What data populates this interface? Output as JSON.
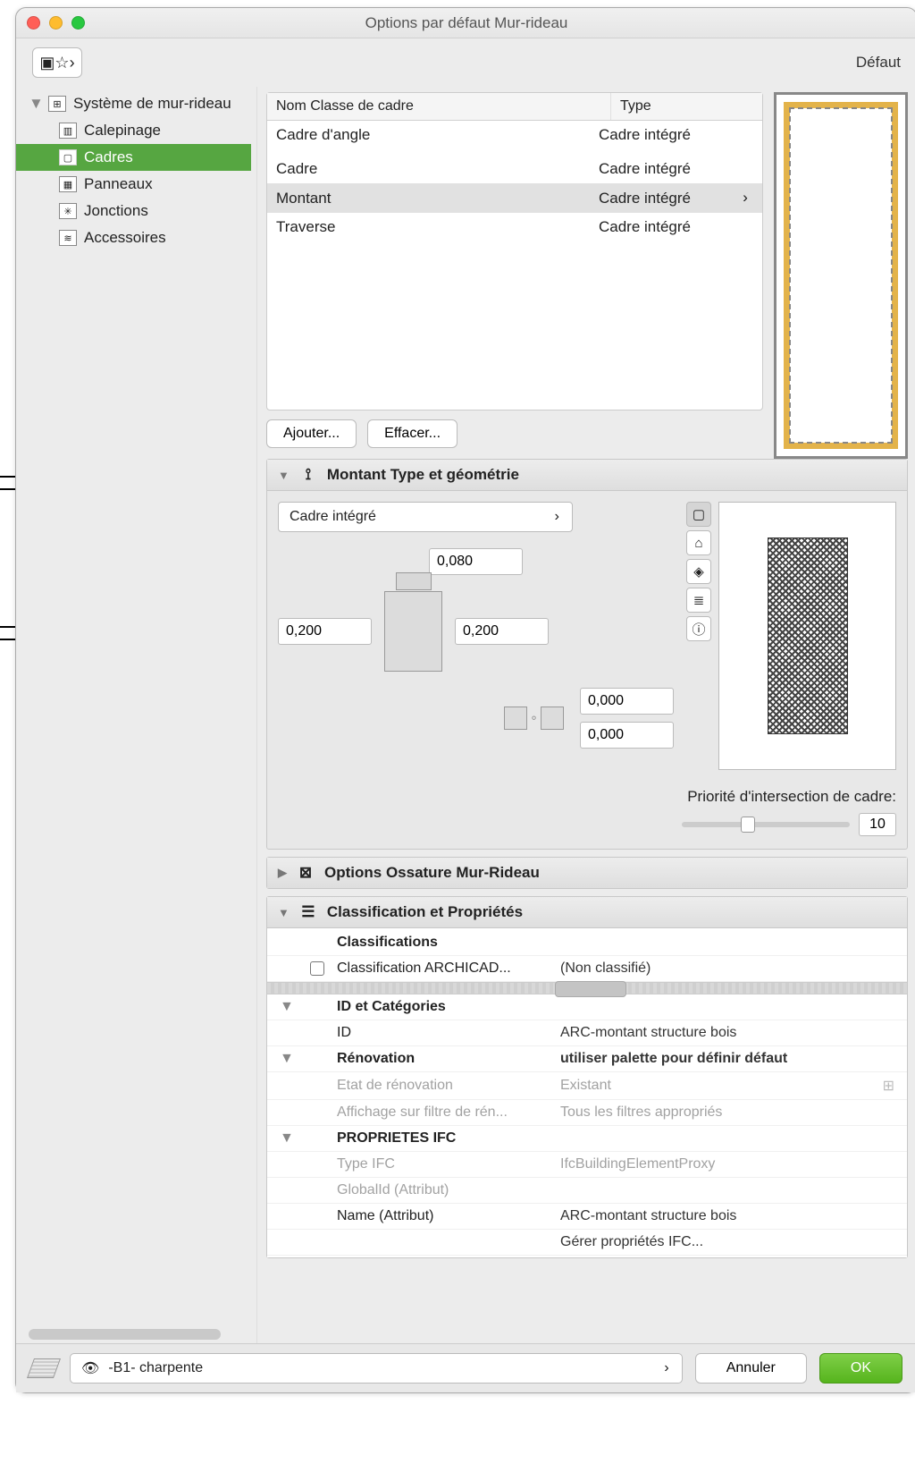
{
  "window": {
    "title": "Options par défaut Mur-rideau",
    "default_label": "Défaut"
  },
  "sidebar": {
    "root": "Système de mur-rideau",
    "items": [
      {
        "label": "Calepinage"
      },
      {
        "label": "Cadres"
      },
      {
        "label": "Panneaux"
      },
      {
        "label": "Jonctions"
      },
      {
        "label": "Accessoires"
      }
    ]
  },
  "frame_table": {
    "head_name": "Nom Classe de cadre",
    "head_type": "Type",
    "rows": [
      {
        "name": "Cadre d'angle",
        "type": "Cadre intégré"
      },
      {
        "name": "Cadre",
        "type": "Cadre intégré"
      },
      {
        "name": "Montant",
        "type": "Cadre intégré",
        "selected": true
      },
      {
        "name": "Traverse",
        "type": "Cadre intégré"
      }
    ],
    "add_btn": "Ajouter...",
    "delete_btn": "Effacer..."
  },
  "geom": {
    "panel_title": "Montant Type et géométrie",
    "combo_value": "Cadre intégré",
    "top_dim": "0,080",
    "left_dim": "0,200",
    "right_dim": "0,200",
    "off1": "0,000",
    "off2": "0,000",
    "priority_label": "Priorité d'intersection de cadre:",
    "priority_val": "10"
  },
  "ossature": {
    "panel_title": "Options Ossature Mur-Rideau"
  },
  "classif": {
    "panel_title": "Classification et Propriétés",
    "heading1": "Classifications",
    "row_archicad_label": "Classification ARCHICAD...",
    "row_archicad_val": "(Non classifié)",
    "heading2": "ID et Catégories",
    "id_label": "ID",
    "id_value": "ARC-montant structure bois",
    "heading3": "Rénovation",
    "heading3_val": "utiliser palette pour définir défaut",
    "renov_state_l": "Etat de rénovation",
    "renov_state_v": "Existant",
    "renov_filter_l": "Affichage sur filtre de rén...",
    "renov_filter_v": "Tous les filtres appropriés",
    "heading4": "PROPRIETES IFC",
    "ifc_type_l": "Type IFC",
    "ifc_type_v": "IfcBuildingElementProxy",
    "globalid_l": "GlobalId (Attribut)",
    "name_l": "Name (Attribut)",
    "name_v": "ARC-montant structure bois",
    "manage_l": "Gérer propriétés IFC..."
  },
  "footer": {
    "layer": "-B1- charpente",
    "cancel": "Annuler",
    "ok": "OK"
  }
}
